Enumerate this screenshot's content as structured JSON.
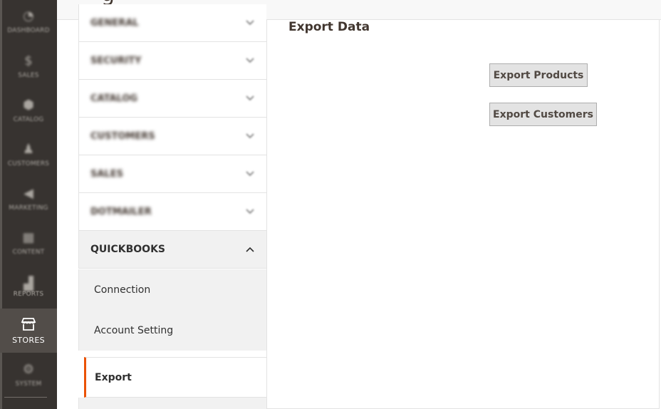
{
  "admin_nav": {
    "items": [
      {
        "label": "Dashboard",
        "icon": "dashboard-icon",
        "glyph": "◔"
      },
      {
        "label": "Sales",
        "icon": "dollar-icon",
        "glyph": "$"
      },
      {
        "label": "Catalog",
        "icon": "box-icon",
        "glyph": "⬢"
      },
      {
        "label": "Customers",
        "icon": "person-icon",
        "glyph": "♟"
      },
      {
        "label": "Marketing",
        "icon": "megaphone-icon",
        "glyph": "◀"
      },
      {
        "label": "Content",
        "icon": "layout-icon",
        "glyph": "▦"
      },
      {
        "label": "Reports",
        "icon": "bar-chart-icon",
        "glyph": "▟"
      },
      {
        "label": "Stores",
        "icon": "storefront-icon",
        "glyph": "⌂"
      },
      {
        "label": "System",
        "icon": "gear-icon",
        "glyph": "⚙"
      }
    ],
    "active": "Stores"
  },
  "config_tabs": {
    "sections": [
      {
        "label": "General"
      },
      {
        "label": "Security"
      },
      {
        "label": "Catalog"
      },
      {
        "label": "Customers"
      },
      {
        "label": "Sales"
      },
      {
        "label": "Dotmailer"
      },
      {
        "label": "QUICKBOOKS"
      }
    ],
    "quickbooks_items": [
      {
        "label": "Connection"
      },
      {
        "label": "Account Setting"
      },
      {
        "label": "Export"
      }
    ]
  },
  "main": {
    "title": "Export Data",
    "buttons": {
      "export_products": "Export Products",
      "export_customers": "Export Customers"
    }
  },
  "colors": {
    "nav_bg": "#373330",
    "nav_active_bg": "#524d49",
    "accent": "#eb5202",
    "button_bg": "#e3e3e3"
  }
}
